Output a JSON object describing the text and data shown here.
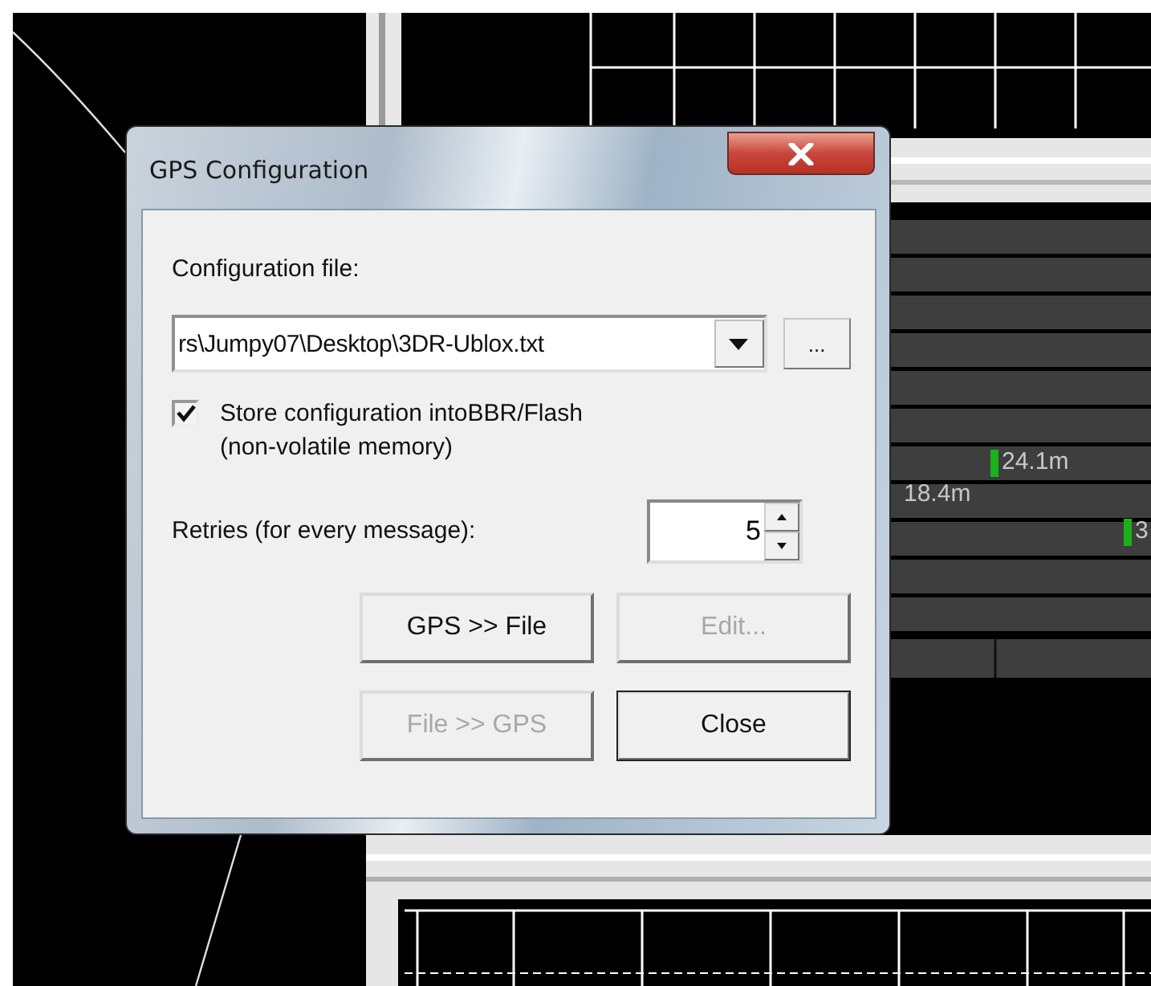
{
  "dialog": {
    "title": "GPS Configuration",
    "config_label": "Configuration file:",
    "config_file": {
      "value": "rs\\Jumpy07\\Desktop\\3DR-Ublox.txt"
    },
    "browse_button": "...",
    "store_option": {
      "label": "Store configuration intoBBR/Flash\n(non-volatile memory)",
      "checked": true
    },
    "retries": {
      "label": "Retries (for every message):",
      "value": "5"
    },
    "buttons": [
      {
        "label": "GPS >> File",
        "disabled": false,
        "default": false
      },
      {
        "label": "Edit...",
        "disabled": true,
        "default": false
      },
      {
        "label": "File >> GPS",
        "disabled": true,
        "default": false
      },
      {
        "label": "Close",
        "disabled": false,
        "default": true
      }
    ]
  },
  "background": {
    "track_labels": [
      {
        "label": "24.1m",
        "marker": true
      },
      {
        "label": "18.4m",
        "marker": false
      },
      {
        "label": "3",
        "marker": true
      }
    ]
  }
}
